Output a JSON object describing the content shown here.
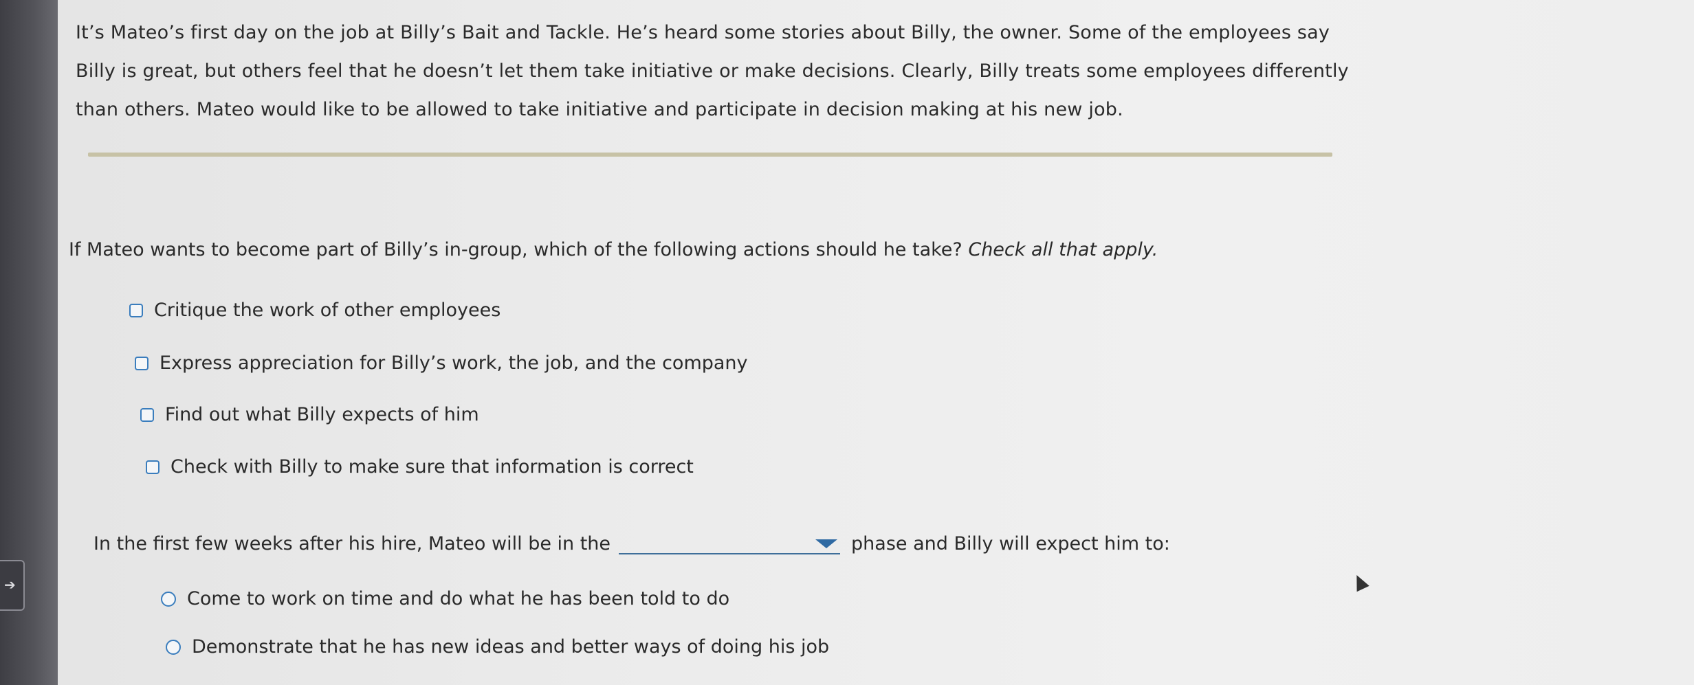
{
  "intro": {
    "lines": [
      "It’s Mateo’s first day on the job at Billy’s Bait and Tackle. He’s heard some stories about Billy, the owner. Some of the employees say",
      "Billy is great, but others feel that he doesn’t let them take initiative or make decisions. Clearly, Billy treats some employees differently",
      "than others. Mateo would like to be allowed to take initiative and participate in decision making at his new job."
    ]
  },
  "question1": {
    "prompt": "If Mateo wants to become part of Billy’s in-group, which of the following actions should he take?",
    "hint": "Check all that apply.",
    "options": [
      "Critique the work of other employees",
      "Express appreciation for Billy’s work, the job, and the company",
      "Find out what Billy expects of him",
      "Check with Billy to make sure that information is correct"
    ]
  },
  "question2": {
    "prefix": "In the first few weeks after his hire, Mateo will be in the",
    "dropdown_value": "",
    "suffix": "phase and Billy will expect him to:",
    "options": [
      "Come to work on time and do what he has been told to do",
      "Demonstrate that he has new ideas and better ways of doing his job"
    ]
  },
  "colors": {
    "accent": "#3a7dbd",
    "rule": "#c7c2a6"
  },
  "icons": {
    "side_tab": "arrow-right-icon",
    "dropdown": "caret-down-icon",
    "cursor": "mouse-pointer-icon"
  }
}
